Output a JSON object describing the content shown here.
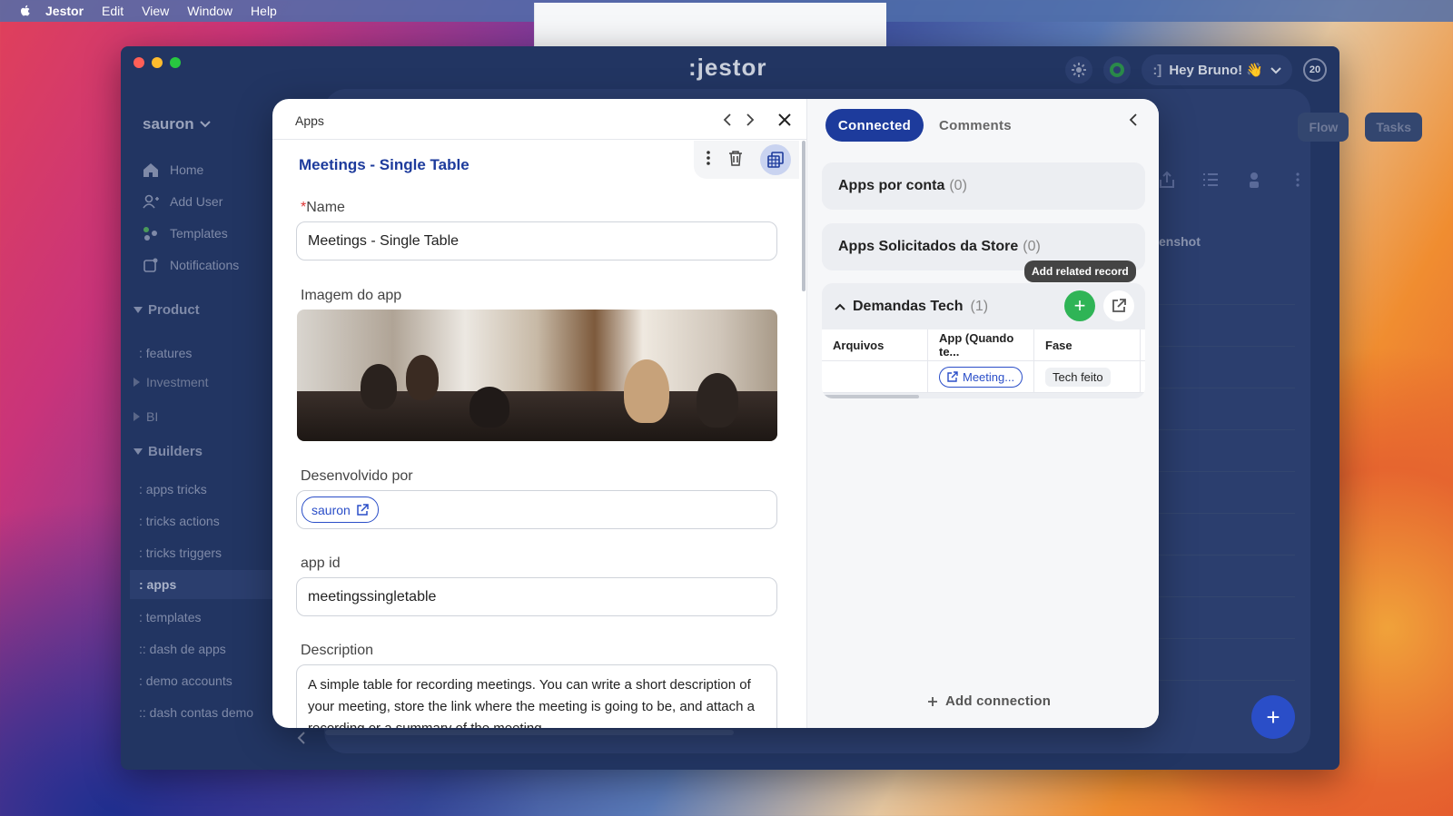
{
  "menubar": {
    "app_name": "Jestor",
    "items": [
      "Edit",
      "View",
      "Window",
      "Help"
    ]
  },
  "window": {
    "logo": ":jestor",
    "greeting": "Hey Bruno! 👋",
    "notifications_count": "20"
  },
  "sidebar": {
    "workspace": "sauron",
    "nav": [
      {
        "label": "Home",
        "icon": "home-icon"
      },
      {
        "label": "Add User",
        "icon": "add-user-icon"
      },
      {
        "label": "Templates",
        "icon": "templates-icon"
      },
      {
        "label": "Notifications",
        "icon": "notifications-icon"
      }
    ],
    "sections": {
      "product": "Product",
      "features": ": features",
      "investment": "Investment",
      "bi": "BI",
      "builders": "Builders"
    },
    "builder_items": [
      ": apps tricks",
      ": tricks actions",
      ": tricks triggers",
      ": apps",
      ": templates",
      ":: dash de apps",
      ": demo accounts",
      ":: dash contas demo"
    ]
  },
  "background": {
    "tabs": [
      "Flow",
      "Tasks"
    ],
    "column_partial": "enshot"
  },
  "record": {
    "breadcrumb": "Apps",
    "title": "Meetings - Single Table",
    "fields": {
      "name_label": "Name",
      "name_value": "Meetings - Single Table",
      "image_label": "Imagem do app",
      "developer_label": "Desenvolvido por",
      "developer_value": "sauron",
      "appid_label": "app id",
      "appid_value": "meetingssingletable",
      "description_label": "Description",
      "description_value": "A simple table for recording meetings. You can write a short description of your meeting, store the link where the meeting is going to be, and attach a recording or a summary of the meeting."
    }
  },
  "panel": {
    "tab_connected": "Connected",
    "tab_comments": "Comments",
    "groups": [
      {
        "name": "Apps por conta",
        "count": "(0)"
      },
      {
        "name": "Apps Solicitados da Store",
        "count": "(0)"
      }
    ],
    "tooltip": "Add related record",
    "demandas": {
      "name": "Demandas Tech",
      "count": "(1)",
      "columns": [
        "Arquivos",
        "App (Quando te...",
        "Fase"
      ],
      "row": {
        "arquivos": "",
        "app": "Meeting...",
        "fase": "Tech feito"
      }
    },
    "add_connection": "Add connection"
  },
  "colors": {
    "accent": "#1d3b9c",
    "green": "#2fb456",
    "window_bg": "#223562"
  }
}
